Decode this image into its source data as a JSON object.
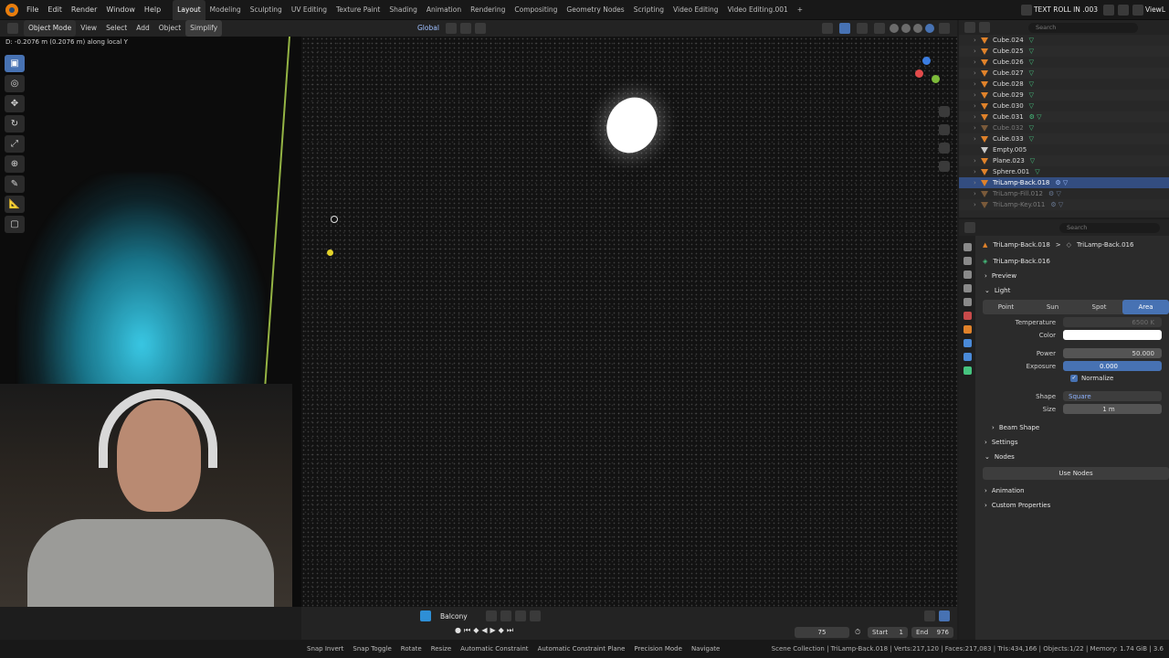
{
  "topbar": {
    "menus": [
      "File",
      "Edit",
      "Render",
      "Window",
      "Help"
    ],
    "workspaces": [
      "Layout",
      "Modeling",
      "Sculpting",
      "UV Editing",
      "Texture Paint",
      "Shading",
      "Animation",
      "Rendering",
      "Compositing",
      "Geometry Nodes",
      "Scripting",
      "Video Editing",
      "Video Editing.001"
    ],
    "active_workspace": "Layout",
    "add_tab": "+",
    "scene_name": "TEXT ROLL IN .003",
    "view_layer": "ViewL"
  },
  "viewport_header": {
    "mode": "Object Mode",
    "menus": [
      "View",
      "Select",
      "Add",
      "Object"
    ],
    "simplify": "Simplify",
    "orientation": "Global"
  },
  "viewport": {
    "status_hint": "D: -0.2076 m (0.2076 m) along local Y"
  },
  "toolbar": {
    "tools": [
      "select-box",
      "cursor",
      "move",
      "rotate",
      "scale",
      "transform",
      "annotate",
      "measure",
      "add-cube"
    ]
  },
  "timeline": {
    "camera": "Balcony",
    "current_frame": "75",
    "start_label": "Start",
    "start": "1",
    "end_label": "End",
    "end": "976"
  },
  "statusbar": {
    "hints": [
      "Snap Invert",
      "Snap Toggle",
      "Rotate",
      "Resize",
      "Automatic Constraint",
      "Automatic Constraint Plane",
      "Precision Mode",
      "Navigate"
    ],
    "stats": "Scene Collection | TriLamp-Back.018 | Verts:217,120 | Faces:217,083 | Tris:434,166 | Objects:1/22 | Memory: 1.74 GiB | 3.6"
  },
  "outliner": {
    "search_placeholder": "Search",
    "items": [
      {
        "name": "Cube.024",
        "state": "normal",
        "mod": "▽"
      },
      {
        "name": "Cube.025",
        "state": "normal",
        "mod": "▽"
      },
      {
        "name": "Cube.026",
        "state": "normal",
        "mod": "▽"
      },
      {
        "name": "Cube.027",
        "state": "normal",
        "mod": "▽"
      },
      {
        "name": "Cube.028",
        "state": "normal",
        "mod": "▽"
      },
      {
        "name": "Cube.029",
        "state": "normal",
        "mod": "▽"
      },
      {
        "name": "Cube.030",
        "state": "normal",
        "mod": "▽"
      },
      {
        "name": "Cube.031",
        "state": "normal",
        "mod": "⚙ ▽"
      },
      {
        "name": "Cube.032",
        "state": "disabled",
        "mod": "▽"
      },
      {
        "name": "Cube.033",
        "state": "normal",
        "mod": "▽"
      },
      {
        "name": "Empty.005",
        "state": "normal",
        "mod": ""
      },
      {
        "name": "Plane.023",
        "state": "normal",
        "mod": "▽"
      },
      {
        "name": "Sphere.001",
        "state": "normal",
        "mod": "▽"
      },
      {
        "name": "TriLamp-Back.018",
        "state": "selected",
        "mod": "⚙ ▽"
      },
      {
        "name": "TriLamp-Fill.012",
        "state": "disabled",
        "mod": "⚙ ▽"
      },
      {
        "name": "TriLamp-Key.011",
        "state": "disabled",
        "mod": "⚙ ▽"
      }
    ]
  },
  "properties": {
    "search_placeholder": "Search",
    "breadcrumb_object": "TriLamp-Back.018",
    "breadcrumb_sep": ">",
    "breadcrumb_data": "TriLamp-Back.016",
    "data_name": "TriLamp-Back.016",
    "preview_label": "Preview",
    "light_label": "Light",
    "light_types": [
      "Point",
      "Sun",
      "Spot",
      "Area"
    ],
    "active_light_type": "Area",
    "temperature_label": "Temperature",
    "temperature_value": "6500 K",
    "color_label": "Color",
    "power_label": "Power",
    "power_value": "50.000",
    "exposure_label": "Exposure",
    "exposure_value": "0.000",
    "normalize_label": "Normalize",
    "shape_label": "Shape",
    "shape_value": "Square",
    "size_label": "Size",
    "size_value": "1 m",
    "beam_shape_label": "Beam Shape",
    "settings_label": "Settings",
    "nodes_label": "Nodes",
    "use_nodes_label": "Use Nodes",
    "animation_label": "Animation",
    "custom_props_label": "Custom Properties"
  },
  "colors": {
    "accent": "#4772b3",
    "selected_row": "#334d80",
    "object_orange": "#e0822a",
    "modifier_green": "#46c47f",
    "flame_cyan": "#3cd2f0"
  }
}
